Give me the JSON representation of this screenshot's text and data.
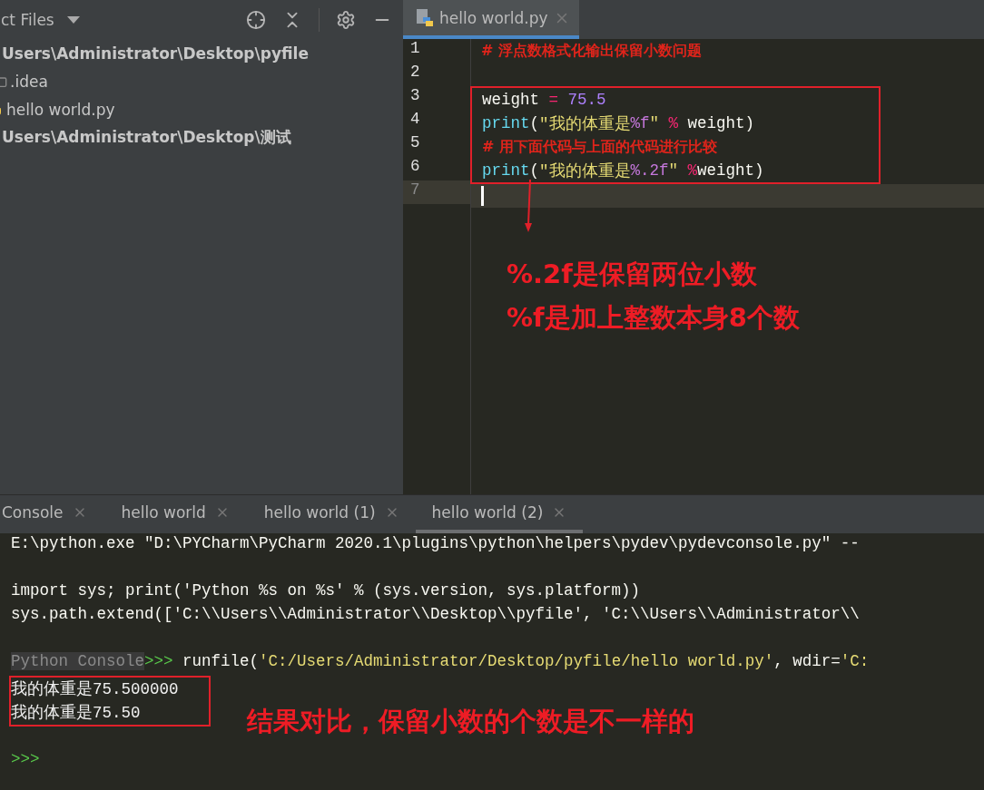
{
  "project_panel": {
    "title": "ct Files",
    "tree": [
      {
        "label": "Users\\Administrator\\Desktop\\pyfile",
        "kind": "root",
        "children": [
          {
            "label": ".idea",
            "kind": "folder"
          },
          {
            "label": "hello world.py",
            "kind": "python"
          }
        ]
      },
      {
        "label": "Users\\Administrator\\Desktop\\测试",
        "kind": "root"
      }
    ]
  },
  "editor": {
    "tabs": [
      {
        "label": "hello world.py",
        "selected": true
      }
    ],
    "lines": [
      {
        "number": "1",
        "current": false,
        "boxed": false,
        "tokens": [
          {
            "kind": "comment",
            "text": "# 浮点数格式化输出保留小数问题"
          }
        ]
      },
      {
        "number": "2",
        "current": false,
        "boxed": false
      },
      {
        "number": "3",
        "current": false,
        "boxed": true,
        "tokens": [
          {
            "kind": "plain",
            "text": "weight "
          },
          {
            "kind": "operator",
            "text": "="
          },
          {
            "kind": "number",
            "text": " 75.5"
          }
        ]
      },
      {
        "number": "4",
        "current": false,
        "boxed": true,
        "tokens": [
          {
            "kind": "builtin",
            "text": "print"
          },
          {
            "kind": "plain",
            "text": "("
          },
          {
            "kind": "string",
            "text": "\"我的体重是"
          },
          {
            "kind": "format",
            "text": "%f"
          },
          {
            "kind": "string",
            "text": "\""
          },
          {
            "kind": "operator",
            "text": " %"
          },
          {
            "kind": "plain",
            "text": " weight)"
          }
        ]
      },
      {
        "number": "5",
        "current": false,
        "boxed": true,
        "tokens": [
          {
            "kind": "comment",
            "text": "# 用下面代码与上面的代码进行比较"
          }
        ]
      },
      {
        "number": "6",
        "current": false,
        "boxed": true,
        "tokens": [
          {
            "kind": "builtin",
            "text": "print"
          },
          {
            "kind": "plain",
            "text": "("
          },
          {
            "kind": "string",
            "text": "\"我的体重是"
          },
          {
            "kind": "format",
            "text": "%.2f"
          },
          {
            "kind": "string",
            "text": "\""
          },
          {
            "kind": "operator",
            "text": " %"
          },
          {
            "kind": "plain",
            "text": "weight)"
          }
        ]
      },
      {
        "number": "7",
        "current": true,
        "boxed": false
      }
    ],
    "annotations": [
      "%.2f是保留两位小数",
      "%f是加上整数本身8个数"
    ]
  },
  "console": {
    "tabs": [
      {
        "label": "Console",
        "selected": false
      },
      {
        "label": "hello world",
        "selected": false
      },
      {
        "label": "hello world (1)",
        "selected": false
      },
      {
        "label": "hello world (2)",
        "selected": true
      }
    ],
    "lines": [
      {
        "boxed": false,
        "tokens": [
          {
            "kind": "plain",
            "text": "E:\\python.exe \"D:\\PYCharm\\PyCharm 2020.1\\plugins\\python\\helpers\\pydev\\pydevconsole.py\" --"
          }
        ]
      },
      {
        "boxed": false
      },
      {
        "boxed": false,
        "tokens": [
          {
            "kind": "plain",
            "text": "import sys; print('Python %s on %s' % (sys.version, sys.platform))"
          }
        ]
      },
      {
        "boxed": false,
        "tokens": [
          {
            "kind": "plain",
            "text": "sys.path.extend(['C:\\\\Users\\\\Administrator\\\\Desktop\\\\pyfile', 'C:\\\\Users\\\\Administrator\\\\"
          }
        ]
      },
      {
        "boxed": false
      },
      {
        "boxed": false,
        "tokens": [
          {
            "kind": "label",
            "text": "Python Console"
          },
          {
            "kind": "prompt",
            "text": ">>>"
          },
          {
            "kind": "plain",
            "text": " runfile("
          },
          {
            "kind": "string",
            "text": "'C:/Users/Administrator/Desktop/pyfile/hello world.py'"
          },
          {
            "kind": "plain",
            "text": ", wdir="
          },
          {
            "kind": "string",
            "text": "'C:"
          }
        ]
      },
      {
        "boxed": true,
        "tokens": [
          {
            "kind": "output",
            "text": "我的体重是75.500000"
          }
        ]
      },
      {
        "boxed": true,
        "tokens": [
          {
            "kind": "output",
            "text": "我的体重是75.50"
          }
        ]
      },
      {
        "boxed": false
      },
      {
        "boxed": false,
        "tokens": [
          {
            "kind": "prompt",
            "text": ">>>"
          }
        ]
      }
    ],
    "annotation": "结果对比，保留小数的个数是不一样的"
  }
}
